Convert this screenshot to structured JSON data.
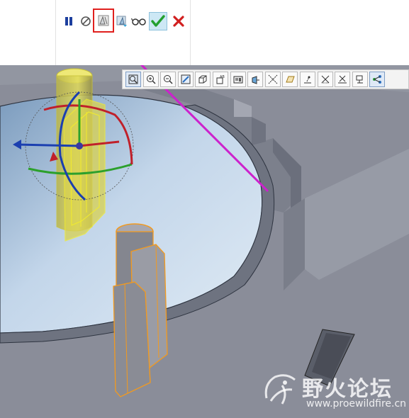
{
  "dashboard": {
    "buttons": [
      {
        "name": "pause-button",
        "icon": "pause-icon"
      },
      {
        "name": "no-preview-button",
        "icon": "circle-slash-icon"
      },
      {
        "name": "static-preview-button",
        "icon": "static-part-icon",
        "highlighted": true
      },
      {
        "name": "dynamic-preview-button",
        "icon": "dynamic-part-icon"
      },
      {
        "name": "verify-button",
        "icon": "glasses-icon"
      },
      {
        "name": "apply-button",
        "icon": "green-checkmark-icon"
      },
      {
        "name": "cancel-button",
        "icon": "red-x-icon"
      }
    ]
  },
  "graphics_toolbar": {
    "buttons": [
      {
        "name": "refit-button",
        "icon": "zoom-fit-icon"
      },
      {
        "name": "zoom-in-button",
        "icon": "zoom-in-icon"
      },
      {
        "name": "zoom-out-button",
        "icon": "zoom-out-icon"
      },
      {
        "name": "repaint-button",
        "icon": "repaint-icon"
      },
      {
        "name": "display-style-button",
        "icon": "display-style-icon"
      },
      {
        "name": "saved-views-button",
        "icon": "saved-orientations-icon"
      },
      {
        "name": "view-manager-button",
        "icon": "view-manager-icon"
      },
      {
        "name": "perspective-button",
        "icon": "perspective-icon"
      },
      {
        "name": "datum-axis-display-button",
        "icon": "axis-display-icon"
      },
      {
        "name": "datum-plane-display-button",
        "icon": "plane-display-icon"
      },
      {
        "name": "datum-point-display-button",
        "icon": "point-display-icon"
      },
      {
        "name": "csys-display-button",
        "icon": "csys-display-icon"
      },
      {
        "name": "spin-center-display-button",
        "icon": "spin-center-icon"
      },
      {
        "name": "annotation-display-button",
        "icon": "annotation-display-icon"
      },
      {
        "name": "network-display-button",
        "icon": "network-icon"
      }
    ]
  },
  "watermark": {
    "title": "野火论坛",
    "url": "www.proewildfire.cn"
  },
  "colors": {
    "highlight_box": "#e0201e",
    "arrow": "#cc22cc",
    "selected_part": "#e8e23a",
    "preview_part": "#f39a1e",
    "model_gray": "#8d909b",
    "floor_blue": "#c3d6ea"
  }
}
